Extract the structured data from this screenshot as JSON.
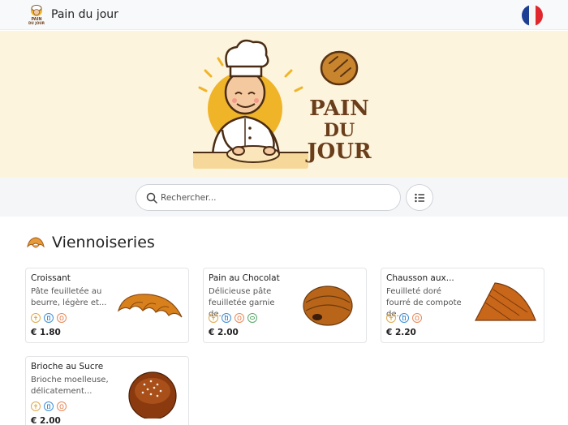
{
  "header": {
    "title": "Pain du jour",
    "logo_text": "PAIN DU JOUR",
    "language_flag": "fr-flag"
  },
  "hero": {
    "brand_line1": "PAIN",
    "brand_line2": "DU",
    "brand_line3": "JOUR"
  },
  "search": {
    "placeholder": "Rechercher..."
  },
  "section": {
    "title": "Viennoiseries",
    "icon": "croissant-icon"
  },
  "products": [
    {
      "name": "Croissant",
      "description": "Pâte feuilletée au beurre, légère et...",
      "price": "€ 1.80",
      "allergens": [
        "gluten-icon",
        "milk-icon",
        "egg-icon"
      ],
      "image": "croissant-image"
    },
    {
      "name": "Pain au Chocolat",
      "description": "Délicieuse pâte feuilletée garnie de...",
      "price": "€ 2.00",
      "allergens": [
        "gluten-icon",
        "milk-icon",
        "egg-icon",
        "soy-icon"
      ],
      "image": "pain-au-chocolat-image"
    },
    {
      "name": "Chausson aux...",
      "description": "Feuilleté doré fourré de compote de...",
      "price": "€ 2.20",
      "allergens": [
        "gluten-icon",
        "milk-icon",
        "egg-icon"
      ],
      "image": "chausson-image"
    },
    {
      "name": "Brioche au Sucre",
      "description": "Brioche moelleuse, délicatement...",
      "price": "€ 2.00",
      "allergens": [
        "gluten-icon",
        "milk-icon",
        "egg-icon"
      ],
      "image": "brioche-image"
    }
  ],
  "colors": {
    "hero_background": "#fdf4dd",
    "brand_brown": "#6b3e1b",
    "brand_gold": "#f0b429",
    "allergen_gluten": "#e0a94a",
    "allergen_milk": "#3f8fd6",
    "allergen_egg": "#e8895a",
    "allergen_soy": "#5aa86a"
  }
}
